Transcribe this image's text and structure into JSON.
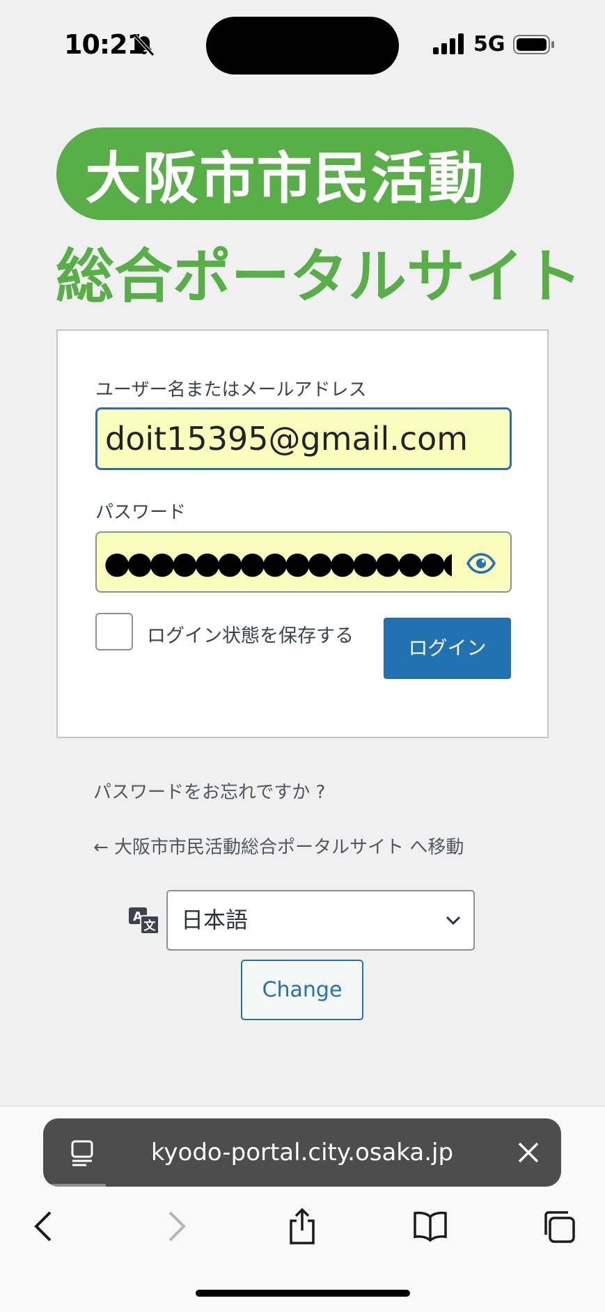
{
  "status": {
    "time": "10:21",
    "network": "5G"
  },
  "logo": {
    "line1": "大阪市市民活動",
    "line2": "総合ポータルサイト"
  },
  "form": {
    "username_label": "ユーザー名またはメールアドレス",
    "username_value": "doit15395@gmail.com",
    "password_label": "パスワード",
    "password_mask": "●●●●●●●●●●●●●●●●●",
    "remember_label": "ログイン状態を保存する",
    "login_button": "ログイン"
  },
  "links": {
    "lost_password": "パスワードをお忘れですか ?",
    "back_to_site": "← 大阪市市民活動総合ポータルサイト へ移動"
  },
  "language": {
    "selected": "日本語",
    "change_button": "Change"
  },
  "browser": {
    "url": "kyodo-portal.city.osaka.jp"
  },
  "colors": {
    "brand_green": "#58ae47",
    "primary_blue": "#2271b1",
    "autofill_yellow": "#fafdbb"
  }
}
